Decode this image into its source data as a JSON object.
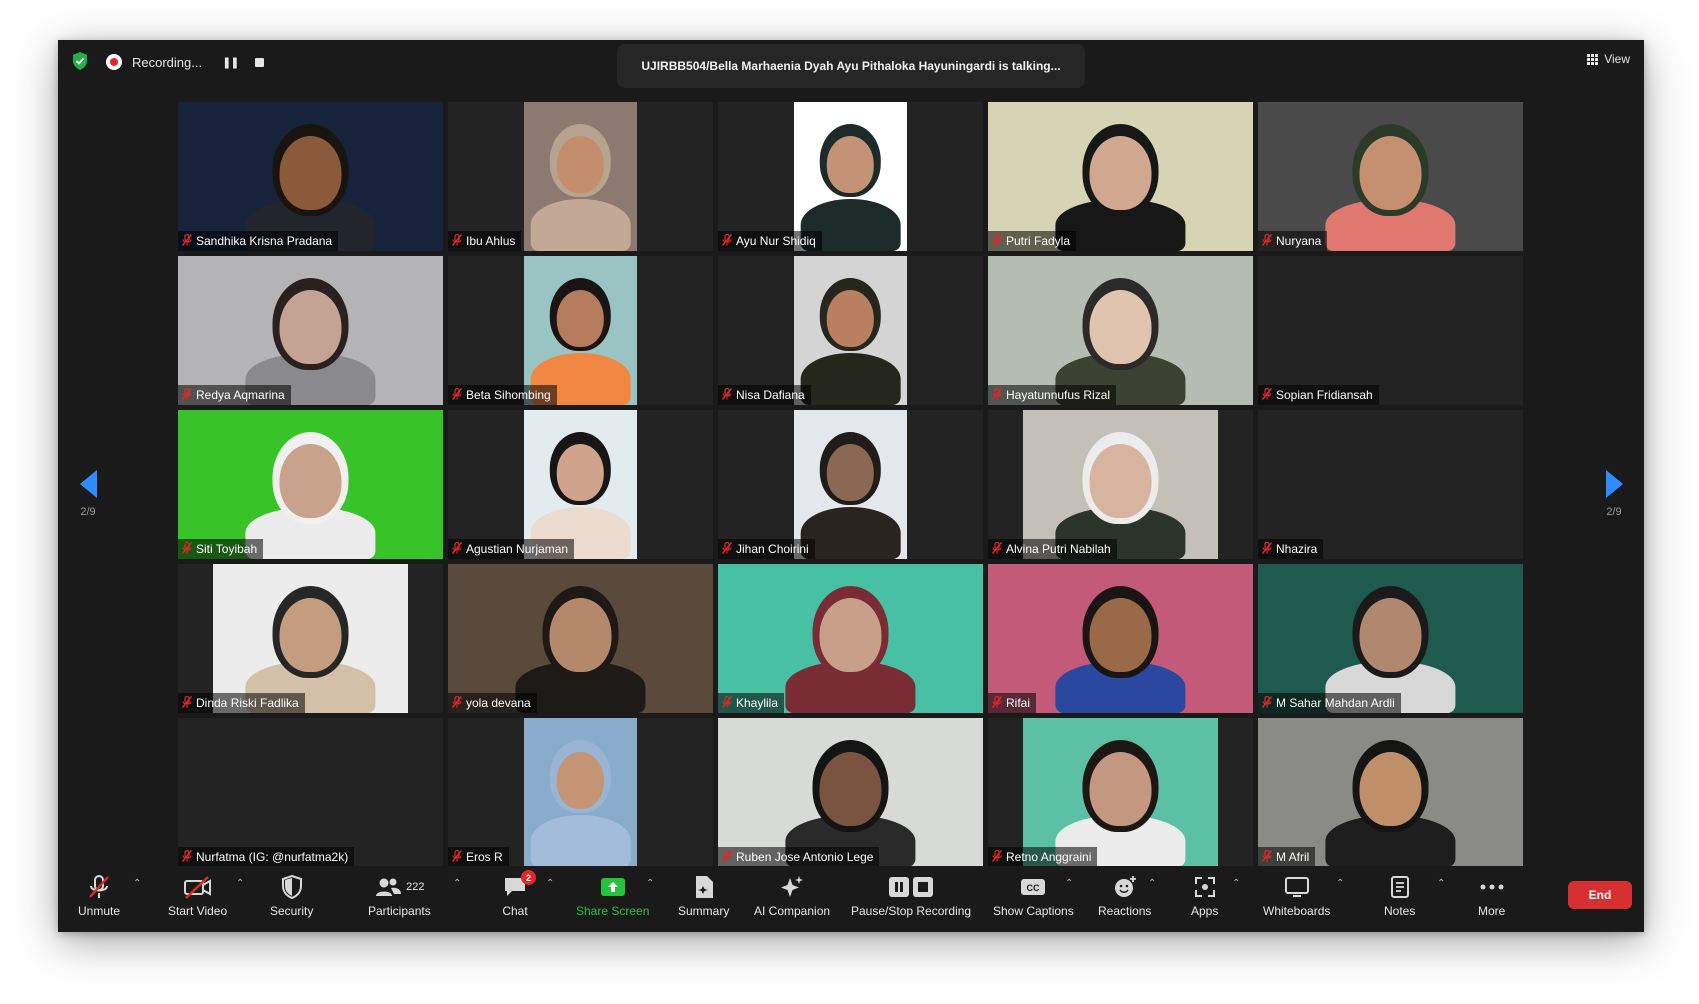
{
  "recording": {
    "label": "Recording..."
  },
  "talking": {
    "text": "UJIRBB504/Bella Marhaenia Dyah Ayu Pithaloka Hayuningardi is talking..."
  },
  "view": {
    "label": "View"
  },
  "pagination": {
    "left_label": "2/9",
    "right_label": "2/9"
  },
  "participants_grid": [
    {
      "name": "Sandhika Krisna Pradana",
      "bg": "#16233a",
      "skin": "#8a5a3a",
      "hair": "#1a1410",
      "shirt": "#22252b",
      "feed": "full"
    },
    {
      "name": "Ibu Ahlus",
      "bg": "#8c7a70",
      "skin": "#c48e6c",
      "hair": "#b6a390",
      "shirt": "#c4a896",
      "feed": "center"
    },
    {
      "name": "Ayu Nur Shidiq",
      "bg": "#ffffff",
      "skin": "#c49274",
      "hair": "#1c2a2a",
      "shirt": "#1c2a2a",
      "feed": "center"
    },
    {
      "name": "Putri Fadyla",
      "bg": "#d6d4b4",
      "skin": "#d0a890",
      "hair": "#171717",
      "shirt": "#171717",
      "feed": "full"
    },
    {
      "name": "Nuryana",
      "bg": "#4a4a4a",
      "skin": "#c49070",
      "hair": "#2c3a2a",
      "shirt": "#e07870",
      "feed": "full"
    },
    {
      "name": "Redya Aqmarina",
      "bg": "#b4b4b6",
      "skin": "#c4a294",
      "hair": "#2a2020",
      "shirt": "#8a8a8c",
      "feed": "full"
    },
    {
      "name": "Beta Sihombing",
      "bg": "#9ac4c2",
      "skin": "#b47c5c",
      "hair": "#1a1414",
      "shirt": "#f08844",
      "feed": "center"
    },
    {
      "name": "Nisa Dafiana",
      "bg": "#d4d4d4",
      "skin": "#b88060",
      "hair": "#26271c",
      "shirt": "#26271c",
      "feed": "center"
    },
    {
      "name": "Hayatunnufus Rizal",
      "bg": "#b4bcb4",
      "skin": "#e0c4b0",
      "hair": "#2c2a28",
      "shirt": "#3c4232",
      "feed": "full"
    },
    {
      "name": "Sopian Fridiansah",
      "bg": "",
      "feed": "none"
    },
    {
      "name": "Siti Toyibah",
      "bg": "#38c428",
      "skin": "#c8a28a",
      "hair": "#f0f0f0",
      "shirt": "#ececec",
      "feed": "full"
    },
    {
      "name": "Agustian Nurjaman",
      "bg": "#e2ecee",
      "skin": "#d0a48c",
      "hair": "#181614",
      "shirt": "#ecdcd0",
      "feed": "center"
    },
    {
      "name": "Jihan Choirini",
      "bg": "#e4e8ec",
      "skin": "#8a6854",
      "hair": "#201c1a",
      "shirt": "#2a2420",
      "feed": "center"
    },
    {
      "name": "Alvina Putri Nabilah",
      "bg": "#c4c0b8",
      "skin": "#d8b4a0",
      "hair": "#ececec",
      "shirt": "#2a342a",
      "feed": "centerw"
    },
    {
      "name": "Nhazira",
      "bg": "",
      "feed": "none"
    },
    {
      "name": "Dinda Riski Fadlika",
      "bg": "#ececec",
      "skin": "#c49c80",
      "hair": "#262626",
      "shirt": "#d4c0a8",
      "feed": "centerw"
    },
    {
      "name": "yola devana",
      "bg": "#5a4a3c",
      "skin": "#b4886a",
      "hair": "#201814",
      "shirt": "#1e1a18",
      "feed": "full"
    },
    {
      "name": "Khaylila",
      "bg": "#48c0a4",
      "skin": "#c8a08a",
      "hair": "#7a2c34",
      "shirt": "#7a2c34",
      "feed": "full"
    },
    {
      "name": "Rifai",
      "bg": "#c45a7a",
      "skin": "#9a6a48",
      "hair": "#1a1414",
      "shirt": "#2a48a0",
      "feed": "full"
    },
    {
      "name": "M Sahar Mahdan Ardli",
      "bg": "#1e5a4e",
      "skin": "#b08870",
      "hair": "#1a1a1a",
      "shirt": "#d8d8d8",
      "feed": "full"
    },
    {
      "name": "Nurfatma (IG: @nurfatma2k)",
      "bg": "",
      "feed": "none"
    },
    {
      "name": "Eros R",
      "bg": "#8aaccc",
      "skin": "#c49474",
      "hair": "#9ab4d4",
      "shirt": "#a4bcdc",
      "feed": "center"
    },
    {
      "name": "Ruben Jose Antonio Lege",
      "bg": "#d8dad8",
      "skin": "#7a5440",
      "hair": "#141414",
      "shirt": "#2a2a2a",
      "feed": "full"
    },
    {
      "name": "Retno Anggraini",
      "bg": "#5cc0a4",
      "skin": "#c49880",
      "hair": "#1c1614",
      "shirt": "#ececec",
      "feed": "centerw"
    },
    {
      "name": "M Afril",
      "bg": "#8a8a86",
      "skin": "#c08e68",
      "hair": "#141414",
      "shirt": "#1e1e1e",
      "feed": "full"
    }
  ],
  "toolbar": {
    "unmute": "Unmute",
    "start_video": "Start Video",
    "security": "Security",
    "participants": "Participants",
    "participants_count": "222",
    "chat": "Chat",
    "chat_badge": "2",
    "share_screen": "Share Screen",
    "summary": "Summary",
    "ai_companion": "AI Companion",
    "pause_stop_recording": "Pause/Stop Recording",
    "show_captions": "Show Captions",
    "reactions": "Reactions",
    "apps": "Apps",
    "whiteboards": "Whiteboards",
    "notes": "Notes",
    "more": "More",
    "end": "End"
  },
  "colors": {
    "accent_blue": "#2d8cff",
    "share_green": "#27c23d",
    "end_red": "#d63030",
    "muted_red": "#e02828",
    "window_bg": "#1a1a1a"
  }
}
